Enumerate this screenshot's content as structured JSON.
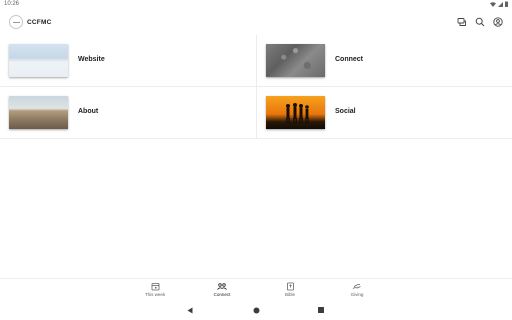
{
  "status": {
    "time": "10:26"
  },
  "app": {
    "name": "CCFMC"
  },
  "tiles": [
    {
      "label": "Website"
    },
    {
      "label": "Connect"
    },
    {
      "label": "About"
    },
    {
      "label": "Social"
    }
  ],
  "nav": {
    "items": [
      {
        "label": "This week",
        "icon": "calendar-icon"
      },
      {
        "label": "Connect",
        "icon": "people-icon",
        "active": true
      },
      {
        "label": "Bible",
        "icon": "book-icon"
      },
      {
        "label": "Giving",
        "icon": "giving-icon"
      }
    ]
  },
  "colors": {
    "text": "#202124",
    "muted": "#5f6368",
    "divider": "#ececec"
  }
}
